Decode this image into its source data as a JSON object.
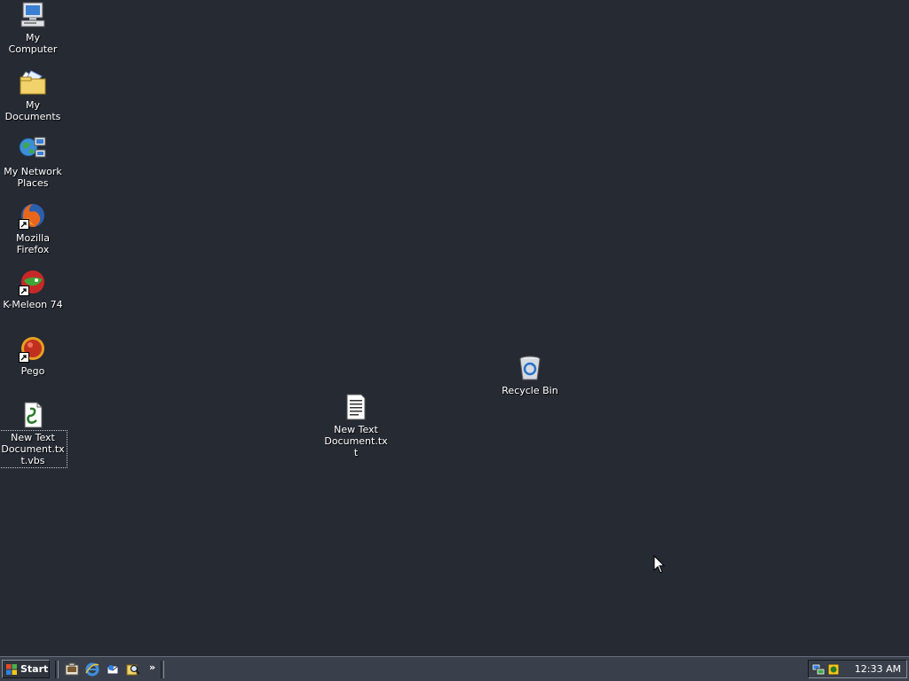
{
  "desktop": {
    "icons": [
      {
        "label": "My Computer",
        "icon": "computer-icon"
      },
      {
        "label": "My Documents",
        "icon": "folder-documents-icon"
      },
      {
        "label": "My Network Places",
        "icon": "network-places-icon"
      },
      {
        "label": "Mozilla Firefox",
        "icon": "firefox-icon"
      },
      {
        "label": "K-Meleon 74",
        "icon": "k-meleon-icon"
      },
      {
        "label": "Pego",
        "icon": "pego-icon"
      },
      {
        "label": "New Text Document.txt.vbs",
        "icon": "vbs-script-icon"
      },
      {
        "label": "Recycle Bin",
        "icon": "recycle-bin-icon"
      },
      {
        "label": "New Text Document.txt",
        "icon": "text-document-icon"
      }
    ]
  },
  "taskbar": {
    "start_label": "Start",
    "quick_launch": [
      {
        "icon": "show-desktop-icon"
      },
      {
        "icon": "internet-explorer-icon"
      },
      {
        "icon": "outlook-express-icon"
      },
      {
        "icon": "search-icon"
      }
    ],
    "more_label": "»",
    "tray": {
      "icons": [
        "network-tray-icon",
        "security-tray-icon"
      ],
      "clock": "12:33 AM"
    }
  },
  "colors": {
    "desktop_bg": "#252a33",
    "taskbar_bg": "#3a404b"
  }
}
